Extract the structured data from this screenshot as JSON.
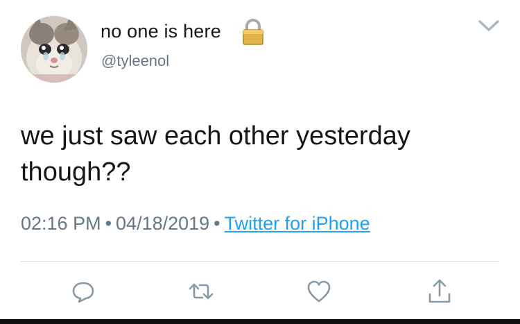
{
  "user": {
    "display_name": "no one is here",
    "handle": "@tyleenol"
  },
  "tweet": {
    "text": "we just saw each other yesterday though??",
    "time": "02:16 PM",
    "date": "04/18/2019",
    "separator": "•",
    "source": "Twitter for iPhone"
  },
  "icons": {
    "lock": "lock-icon",
    "more": "chevron-down-icon",
    "reply": "reply-icon",
    "retweet": "retweet-icon",
    "like": "heart-icon",
    "share": "share-icon"
  },
  "colors": {
    "text": "#14171a",
    "secondary": "#657786",
    "link": "#1da1f2",
    "icon": "#8899a6",
    "divider": "#d9dde0"
  }
}
